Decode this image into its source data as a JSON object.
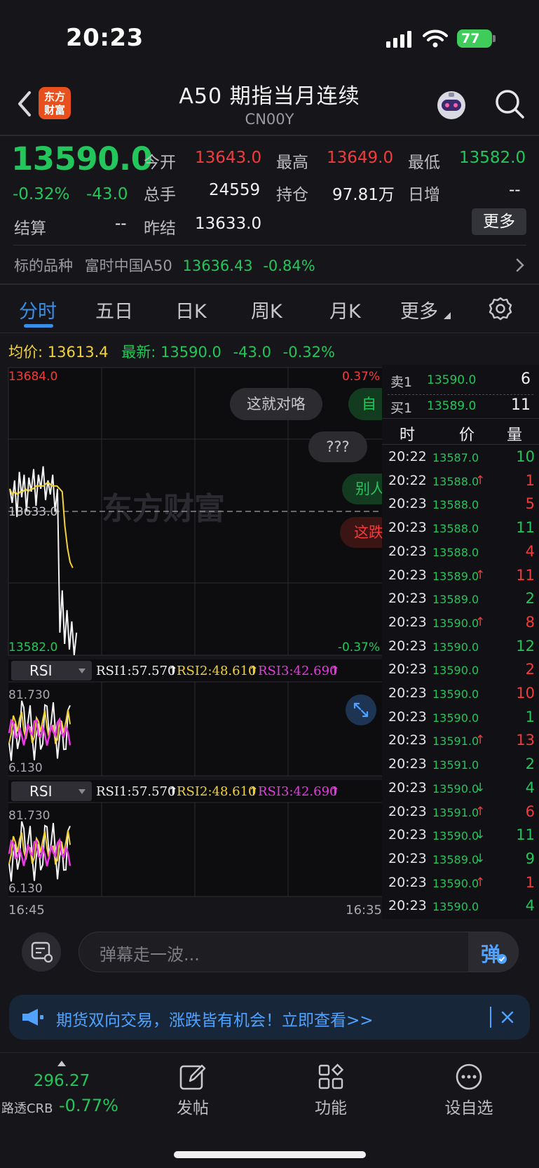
{
  "status": {
    "time": "20:23",
    "battery": "77"
  },
  "header": {
    "title": "A50 期指当月连续",
    "code": "CN00Y",
    "logo_text": "东方财富"
  },
  "quote": {
    "last_price": "13590.0",
    "change_pct": "-0.32%",
    "change": "-43.0",
    "settle_label": "结算",
    "settle_value": "--",
    "fields": [
      {
        "label": "今开",
        "value": "13643.0"
      },
      {
        "label": "最高",
        "value": "13649.0"
      },
      {
        "label": "最低",
        "value": "13582.0"
      },
      {
        "label": "总手",
        "value": "24559"
      },
      {
        "label": "持仓",
        "value": "97.81万"
      },
      {
        "label": "日增",
        "value": "--"
      },
      {
        "label": "昨结",
        "value": "13633.0"
      }
    ],
    "more_label": "更多",
    "underlying_label": "标的品种",
    "underlying_name": "富时中国A50",
    "underlying_price": "13636.43",
    "underlying_pct": "-0.84%"
  },
  "tabs": [
    "分时",
    "五日",
    "日K",
    "周K",
    "月K",
    "更多"
  ],
  "chart_info": {
    "avg_label": "均价:",
    "avg_value": "13613.4",
    "latest_label": "最新:",
    "latest_value": "13590.0",
    "latest_change": "-43.0",
    "latest_pct": "-0.32%"
  },
  "chart_data": {
    "type": "line",
    "series": [
      {
        "values": [
          13641,
          13636,
          13644,
          13631,
          13647,
          13638,
          13646,
          13633,
          13645,
          13640,
          13648,
          13635,
          13646,
          13641,
          13649,
          13637,
          13644,
          13639,
          13646,
          13633,
          13641,
          13590,
          13605,
          13586,
          13598,
          13584,
          13594,
          13582,
          13590
        ]
      },
      {
        "values": [
          13641,
          13639,
          13640,
          13639,
          13640,
          13640,
          13641,
          13640,
          13641,
          13641,
          13642,
          13642,
          13642,
          13642,
          13643,
          13643,
          13642,
          13642,
          13642,
          13641,
          13640,
          13628,
          13620,
          13615,
          13613
        ]
      }
    ],
    "y_labels": {
      "top": "13684.0",
      "mid": "13633.0",
      "bottom": "13582.0",
      "top_pct": "0.37%",
      "bottom_pct": "-0.37%"
    },
    "ylim": [
      13582,
      13684
    ],
    "x_labels": {
      "start": "16:45",
      "end": "16:35"
    },
    "rsi_panels": [
      {
        "name": "RSI",
        "rsi1": "RSI1:57.570",
        "rsi2": "RSI2:48.610",
        "rsi3": "RSI3:42.690",
        "top": "81.730",
        "bottom": "6.130"
      },
      {
        "name": "RSI",
        "rsi1": "RSI1:57.570",
        "rsi2": "RSI2:48.610",
        "rsi3": "RSI3:42.690",
        "top": "81.730",
        "bottom": "6.130"
      }
    ],
    "watermark": "东方财富",
    "danmaku": [
      "这就对咯",
      "自",
      "???",
      "别人",
      "这跌"
    ]
  },
  "order_book": {
    "ask": {
      "label": "卖1",
      "price": "13590.0",
      "qty": "6"
    },
    "bid": {
      "label": "买1",
      "price": "13589.0",
      "qty": "11"
    },
    "headers": [
      "时",
      "价",
      "量"
    ]
  },
  "ticks": [
    {
      "time": "20:22",
      "price": "13587.0",
      "arrow": "",
      "qty": "10",
      "qcolor": "green"
    },
    {
      "time": "20:22",
      "price": "13588.0",
      "arrow": "↑",
      "qty": "1",
      "qcolor": "red"
    },
    {
      "time": "20:23",
      "price": "13588.0",
      "arrow": "",
      "qty": "5",
      "qcolor": "red"
    },
    {
      "time": "20:23",
      "price": "13588.0",
      "arrow": "",
      "qty": "11",
      "qcolor": "green"
    },
    {
      "time": "20:23",
      "price": "13588.0",
      "arrow": "",
      "qty": "4",
      "qcolor": "red"
    },
    {
      "time": "20:23",
      "price": "13589.0",
      "arrow": "↑",
      "qty": "11",
      "qcolor": "red"
    },
    {
      "time": "20:23",
      "price": "13589.0",
      "arrow": "",
      "qty": "2",
      "qcolor": "green"
    },
    {
      "time": "20:23",
      "price": "13590.0",
      "arrow": "↑",
      "qty": "8",
      "qcolor": "red"
    },
    {
      "time": "20:23",
      "price": "13590.0",
      "arrow": "",
      "qty": "12",
      "qcolor": "green"
    },
    {
      "time": "20:23",
      "price": "13590.0",
      "arrow": "",
      "qty": "2",
      "qcolor": "red"
    },
    {
      "time": "20:23",
      "price": "13590.0",
      "arrow": "",
      "qty": "10",
      "qcolor": "red"
    },
    {
      "time": "20:23",
      "price": "13590.0",
      "arrow": "",
      "qty": "1",
      "qcolor": "green"
    },
    {
      "time": "20:23",
      "price": "13591.0",
      "arrow": "↑",
      "qty": "13",
      "qcolor": "red"
    },
    {
      "time": "20:23",
      "price": "13591.0",
      "arrow": "",
      "qty": "2",
      "qcolor": "green"
    },
    {
      "time": "20:23",
      "price": "13590.0",
      "arrow": "↓",
      "qty": "4",
      "qcolor": "green"
    },
    {
      "time": "20:23",
      "price": "13591.0",
      "arrow": "↑",
      "qty": "6",
      "qcolor": "red"
    },
    {
      "time": "20:23",
      "price": "13590.0",
      "arrow": "↓",
      "qty": "11",
      "qcolor": "green"
    },
    {
      "time": "20:23",
      "price": "13589.0",
      "arrow": "↓",
      "qty": "9",
      "qcolor": "green"
    },
    {
      "time": "20:23",
      "price": "13590.0",
      "arrow": "↑",
      "qty": "1",
      "qcolor": "red"
    },
    {
      "time": "20:23",
      "price": "13590.0",
      "arrow": "",
      "qty": "4",
      "qcolor": "green"
    }
  ],
  "danmaku_input": {
    "placeholder": "弹幕走一波...",
    "send_label": "弹"
  },
  "banner": {
    "text": "期货双向交易，涨跌皆有机会！立即查看>>"
  },
  "bottom_nav": {
    "index_value": "296.27",
    "index_name": "路透CRB",
    "index_pct": "-0.77%",
    "items": [
      "发帖",
      "功能",
      "设自选"
    ]
  },
  "colors": {
    "up": "#f23b3b",
    "down": "#22c65a",
    "accent": "#3a8ee8",
    "avg_line": "#f2d23a"
  }
}
